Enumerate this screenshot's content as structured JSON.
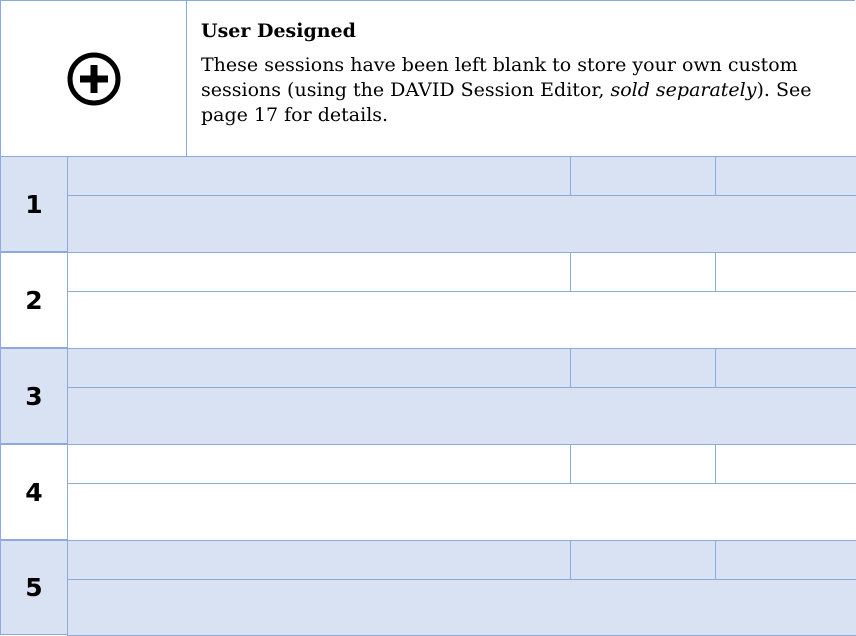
{
  "header": {
    "icon": "plus-circle-icon",
    "title": "User Designed",
    "desc_part1": "These sessions have been left blank to store your own custom sessions (using the DAVID Session Editor, ",
    "desc_italic": "sold separately",
    "desc_part2": "). See page 17 for details."
  },
  "rows": [
    {
      "number": "1",
      "shaded": true
    },
    {
      "number": "2",
      "shaded": false
    },
    {
      "number": "3",
      "shaded": true
    },
    {
      "number": "4",
      "shaded": false
    },
    {
      "number": "5",
      "shaded": true
    }
  ],
  "colors": {
    "border": "#8eaadb",
    "shade": "#d9e2f3"
  }
}
